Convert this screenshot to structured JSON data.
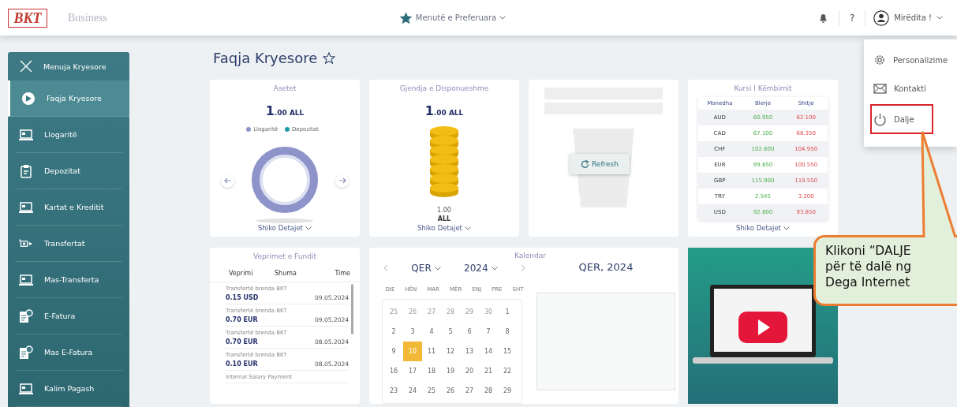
{
  "header": {
    "logo": "BKT",
    "product": "Business",
    "favorites": "Menutë e Preferuara",
    "help": "?",
    "greeting": "Mirëdita !"
  },
  "user_menu": [
    {
      "label": "Personalizime",
      "highlighted": false
    },
    {
      "label": "Kontakti",
      "highlighted": false
    },
    {
      "label": "Dalje",
      "highlighted": true
    }
  ],
  "sidebar": {
    "title": "Menuja Kryesore",
    "items": [
      {
        "label": "Faqja Kryesore",
        "selected": true
      },
      {
        "label": "Llogaritë",
        "selected": false
      },
      {
        "label": "Depozitat",
        "selected": false
      },
      {
        "label": "Kartat e Kreditit",
        "selected": false
      },
      {
        "label": "Transfertat",
        "selected": false
      },
      {
        "label": "Mas-Transferta",
        "selected": false
      },
      {
        "label": "E-Fatura",
        "selected": false
      },
      {
        "label": "Mas E-Fatura",
        "selected": false
      },
      {
        "label": "Kalim Pagash",
        "selected": false
      }
    ]
  },
  "page_title": "Faqja Kryesore",
  "assets_card": {
    "title": "Asetet",
    "amount": "1.00 ALL",
    "legend": [
      {
        "label": "Llogaritë",
        "color": "#8e93c9"
      },
      {
        "label": "Depozitat",
        "color": "#1f9aa8"
      }
    ],
    "link": "Shiko Detajet"
  },
  "balance_card": {
    "title": "Gjendja e Disponueshme",
    "amount": "1.00 ALL",
    "value": "1.00",
    "currency": "ALL",
    "link": "Shiko Detajet"
  },
  "loading_card": {
    "button": "Refresh"
  },
  "rates_card": {
    "title": "Kursi I Këmbimit",
    "columns": [
      "Monedha",
      "Blerje",
      "Shitje"
    ],
    "rows": [
      [
        "AUD",
        "60.950",
        "62.100"
      ],
      [
        "CAD",
        "67.100",
        "68.350"
      ],
      [
        "CHF",
        "102.600",
        "104.950"
      ],
      [
        "EUR",
        "99.850",
        "100.550"
      ],
      [
        "GBP",
        "115.900",
        "119.550"
      ],
      [
        "TRY",
        "2.545",
        "3.200"
      ],
      [
        "USD",
        "92.800",
        "93.850"
      ]
    ],
    "link": "Shiko Detajet"
  },
  "recent_card": {
    "title": "Veprimet e Fundit",
    "columns": [
      "Veprimi",
      "Shuma",
      "Time"
    ],
    "rows": [
      {
        "description": "Transfertë brenda BKT",
        "amount": "0.15 USD",
        "date": "09.05.2024"
      },
      {
        "description": "Transfertë brenda BKT",
        "amount": "0.70 EUR",
        "date": "09.05.2024"
      },
      {
        "description": "Transfertë brenda BKT",
        "amount": "0.70 EUR",
        "date": "08.05.2024"
      },
      {
        "description": "Transfertë brenda BKT",
        "amount": "0.10 EUR",
        "date": "08.05.2024"
      },
      {
        "description": "Internal Salary Payment"
      }
    ]
  },
  "calendar": {
    "title": "Kalendar",
    "month": "QER",
    "year": "2024",
    "heading": "QER, 2024",
    "weekdays": [
      "DIE",
      "HËN",
      "MAR",
      "MËR",
      "ENJ",
      "PRE",
      "SHT"
    ],
    "weeks": [
      [
        {
          "day": "25",
          "outside": true,
          "selected": false
        },
        {
          "day": "26",
          "outside": true,
          "selected": false
        },
        {
          "day": "27",
          "outside": true,
          "selected": false
        },
        {
          "day": "28",
          "outside": true,
          "selected": false
        },
        {
          "day": "29",
          "outside": true,
          "selected": false
        },
        {
          "day": "30",
          "outside": true,
          "selected": false
        },
        {
          "day": "1",
          "outside": false,
          "selected": false
        }
      ],
      [
        {
          "day": "2",
          "outside": false,
          "selected": false
        },
        {
          "day": "3",
          "outside": false,
          "selected": false
        },
        {
          "day": "4",
          "outside": false,
          "selected": false
        },
        {
          "day": "5",
          "outside": false,
          "selected": false
        },
        {
          "day": "6",
          "outside": false,
          "selected": false
        },
        {
          "day": "7",
          "outside": false,
          "selected": false
        },
        {
          "day": "8",
          "outside": false,
          "selected": false
        }
      ],
      [
        {
          "day": "9",
          "outside": false,
          "selected": false
        },
        {
          "day": "10",
          "outside": false,
          "selected": true
        },
        {
          "day": "11",
          "outside": false,
          "selected": false
        },
        {
          "day": "12",
          "outside": false,
          "selected": false
        },
        {
          "day": "13",
          "outside": false,
          "selected": false
        },
        {
          "day": "14",
          "outside": false,
          "selected": false
        },
        {
          "day": "15",
          "outside": false,
          "selected": false
        }
      ],
      [
        {
          "day": "16",
          "outside": false,
          "selected": false
        },
        {
          "day": "17",
          "outside": false,
          "selected": false
        },
        {
          "day": "18",
          "outside": false,
          "selected": false
        },
        {
          "day": "19",
          "outside": false,
          "selected": false
        },
        {
          "day": "20",
          "outside": false,
          "selected": false
        },
        {
          "day": "21",
          "outside": false,
          "selected": false
        },
        {
          "day": "22",
          "outside": false,
          "selected": false
        }
      ],
      [
        {
          "day": "23",
          "outside": false,
          "selected": false
        },
        {
          "day": "24",
          "outside": false,
          "selected": false
        },
        {
          "day": "25",
          "outside": false,
          "selected": false
        },
        {
          "day": "26",
          "outside": false,
          "selected": false
        },
        {
          "day": "27",
          "outside": false,
          "selected": false
        },
        {
          "day": "28",
          "outside": false,
          "selected": false
        },
        {
          "day": "29",
          "outside": false,
          "selected": false
        }
      ]
    ]
  },
  "callout": {
    "lines": [
      "Klikoni “DALJE",
      "për të dalë ng",
      "Dega Internet"
    ]
  }
}
